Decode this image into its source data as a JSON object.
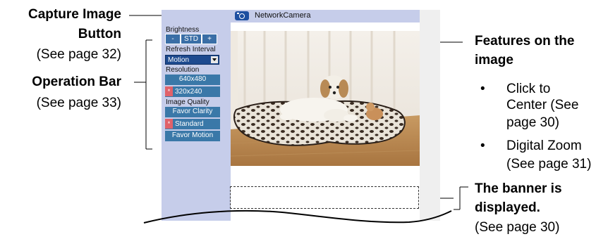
{
  "annotations": {
    "capture": {
      "title_line1": "Capture Image",
      "title_line2": "Button",
      "ref": "(See page 32)"
    },
    "operation": {
      "title": "Operation Bar",
      "ref": "(See page 33)"
    },
    "features": {
      "title_line1": "Features on the",
      "title_line2": "image",
      "items": [
        {
          "bullet": "•",
          "line1": "Click to",
          "line2": "Center (See",
          "line3": "page 30)"
        },
        {
          "bullet": "•",
          "line1": "Digital Zoom",
          "line2": "(See page 31)"
        }
      ]
    },
    "banner": {
      "title_line1": "The banner is",
      "title_line2": "displayed.",
      "ref": "(See page 30)"
    }
  },
  "camera": {
    "title": "NetworkCamera",
    "brightness": {
      "label": "Brightness",
      "minus": "-",
      "std": "STD",
      "plus": "+"
    },
    "refresh": {
      "label": "Refresh Interval",
      "value": "Motion"
    },
    "resolution": {
      "label": "Resolution",
      "options": [
        "640x480",
        "320x240"
      ],
      "selected_marker": "*"
    },
    "quality": {
      "label": "Image Quality",
      "options": [
        "Favor Clarity",
        "Standard",
        "Favor Motion"
      ],
      "selected_marker": "*"
    }
  },
  "colors": {
    "sidebar": "#c6cdea",
    "button": "#3a78a8",
    "marker": "#e0626a"
  }
}
